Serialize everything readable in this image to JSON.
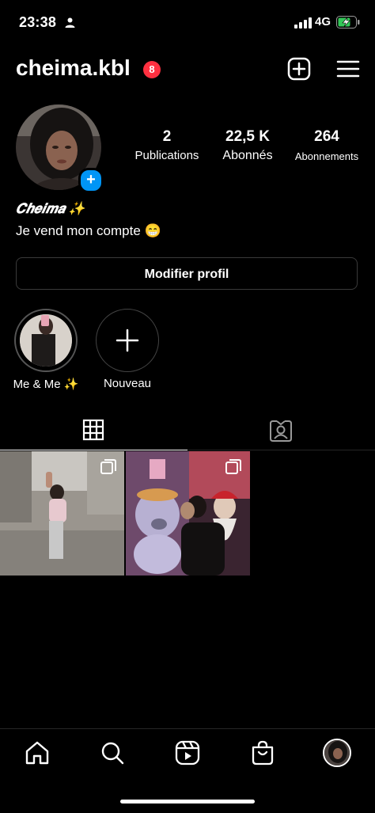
{
  "status_bar": {
    "time": "23:38",
    "network": "4G"
  },
  "header": {
    "username": "cheima.kbl",
    "notification_count": "8"
  },
  "stats": [
    {
      "value": "2",
      "label": "Publications"
    },
    {
      "value": "22,5 K",
      "label": "Abonnés"
    },
    {
      "value": "264",
      "label": "Abonnements"
    }
  ],
  "bio": {
    "name": "𝑪𝒉𝒆𝒊𝒎𝒂 ✨",
    "text": "Je vend mon compte 😁"
  },
  "edit_profile_label": "Modifier profil",
  "highlights": [
    {
      "label": "Me & Me ✨"
    },
    {
      "label": "Nouveau"
    }
  ],
  "icons": {
    "person": "person-icon",
    "signal": "signal-icon",
    "battery": "battery-charging-icon",
    "new_post": "plus-square-icon",
    "menu": "hamburger-menu-icon",
    "grid_tab": "grid-icon",
    "tagged_tab": "tagged-person-icon",
    "home": "home-icon",
    "search": "search-icon",
    "reels": "reels-icon",
    "shop": "shopping-bag-icon",
    "profile": "avatar-icon"
  },
  "colors": {
    "badge_red": "#ff3040",
    "add_blue": "#0095f6",
    "battery_green": "#34c759"
  }
}
